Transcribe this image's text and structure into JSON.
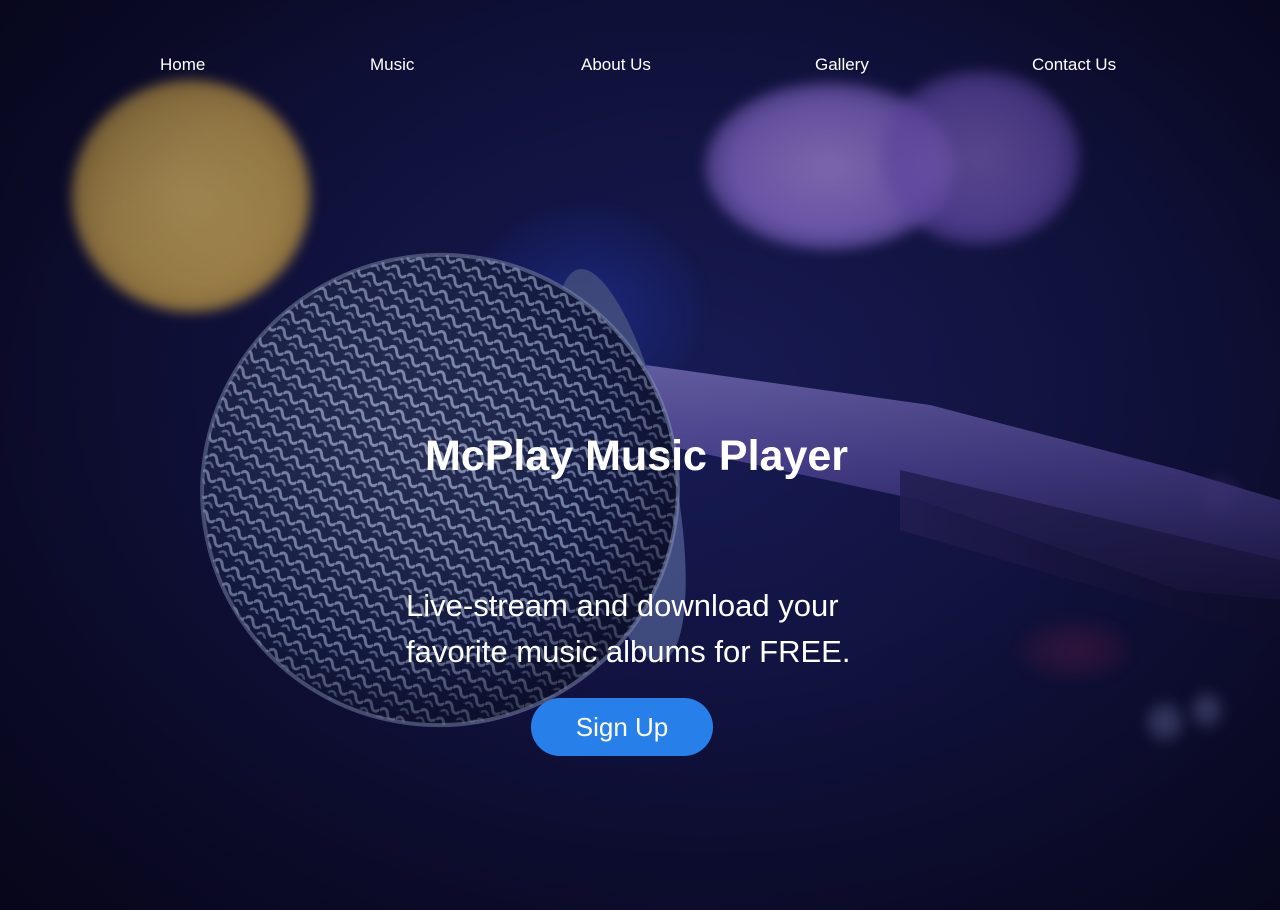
{
  "nav": {
    "items": [
      {
        "label": "Home"
      },
      {
        "label": "Music"
      },
      {
        "label": "About Us"
      },
      {
        "label": "Gallery"
      },
      {
        "label": "Contact Us"
      }
    ]
  },
  "hero": {
    "title": "McPlay Music Player",
    "subtitle": "Live-stream and download your favorite music albums for FREE.",
    "cta_label": "Sign Up"
  },
  "colors": {
    "background": "#14164a",
    "cta": "#2780ea",
    "text": "#ffffff",
    "bokeh_yellow": "#f0c25a",
    "bokeh_purple": "#a27ff0"
  }
}
